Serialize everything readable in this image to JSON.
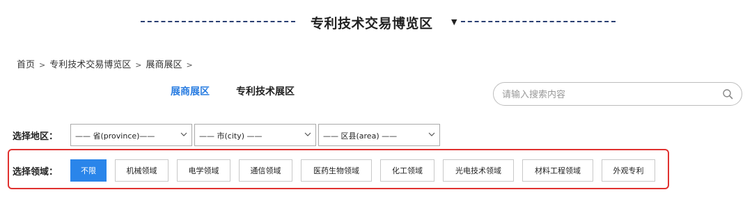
{
  "header": {
    "title": "专利技术交易博览区"
  },
  "breadcrumb": {
    "items": [
      "首页",
      "专利技术交易博览区",
      "展商展区"
    ],
    "separator": ">"
  },
  "tabs": [
    {
      "label": "展商展区",
      "active": true
    },
    {
      "label": "专利技术展区",
      "active": false
    }
  ],
  "search": {
    "placeholder": "请输入搜索内容"
  },
  "region": {
    "label": "选择地区：",
    "province": "—— 省(province)——",
    "city": "—— 市(city) ——",
    "area": "—— 区县(area) ——"
  },
  "field": {
    "label": "选择领域：",
    "options": [
      "不限",
      "机械领域",
      "电学领域",
      "通信领域",
      "医药生物领域",
      "化工领域",
      "光电技术领域",
      "材料工程领域",
      "外观专利"
    ],
    "selected": "不限"
  },
  "colors": {
    "accent": "#2a85ea",
    "tab_active": "#2a7de1",
    "highlight_border": "#e0312f",
    "title_dash": "#2a3f72"
  }
}
